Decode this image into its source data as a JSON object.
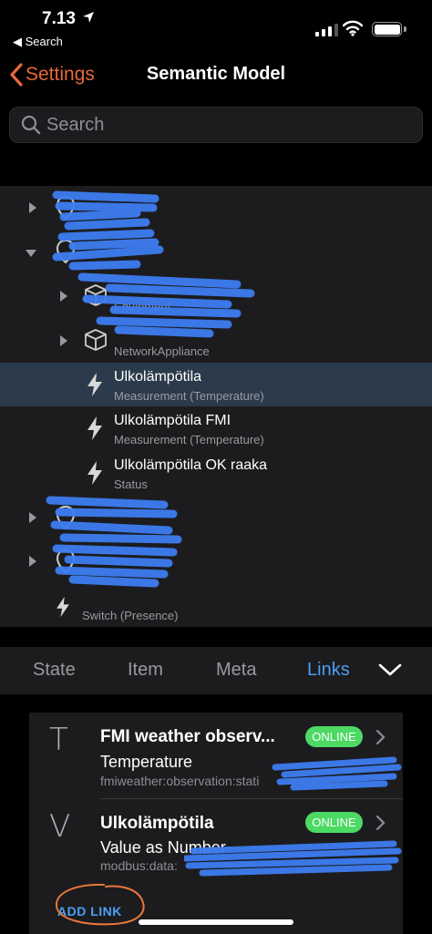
{
  "status_bar": {
    "time": "7.13",
    "back_label": "Search"
  },
  "nav": {
    "back_label": "Settings",
    "title": "Semantic Model"
  },
  "search": {
    "placeholder": "Search",
    "value": ""
  },
  "tree": {
    "rows": [
      {
        "title": "",
        "subtitle": "",
        "icon": "location-pin-icon",
        "expanded": false
      },
      {
        "title": "",
        "subtitle": "",
        "icon": "location-pin-icon",
        "expanded": true
      },
      {
        "title": "",
        "subtitle": "Equipment",
        "icon": "box-icon",
        "expanded": false
      },
      {
        "title": "",
        "subtitle": "NetworkAppliance",
        "icon": "box-icon",
        "expanded": false
      },
      {
        "title": "Ulkolämpötila",
        "subtitle": "Measurement (Temperature)",
        "icon": "bolt-icon",
        "selected": true
      },
      {
        "title": "Ulkolämpötila FMI",
        "subtitle": "Measurement (Temperature)",
        "icon": "bolt-icon"
      },
      {
        "title": "Ulkolämpötila OK raaka",
        "subtitle": "Status",
        "icon": "bolt-icon"
      },
      {
        "title": "",
        "subtitle": "",
        "icon": "location-pin-icon",
        "expanded": false
      },
      {
        "title": "",
        "subtitle": "",
        "icon": "location-pin-icon",
        "expanded": false
      },
      {
        "title": "",
        "subtitle": "Switch (Presence)",
        "icon": "bolt-icon"
      }
    ]
  },
  "tabs": {
    "items": [
      "State",
      "Item",
      "Meta",
      "Links"
    ],
    "active": "Links"
  },
  "links": {
    "items": [
      {
        "letter": "T",
        "title": "FMI weather observ...",
        "subtitle": "Temperature",
        "uid": "fmiweather:observation:stati",
        "status": "ONLINE"
      },
      {
        "letter": "V",
        "title": "Ulkolämpötila",
        "subtitle": "Value as Number",
        "uid": "modbus:data:",
        "status": "ONLINE"
      }
    ],
    "add_label": "ADD LINK"
  },
  "colors": {
    "accent_orange": "#e8673c",
    "accent_blue": "#4a9ff5",
    "online_green": "#4cd964",
    "selected_row": "#2b3b4c"
  }
}
